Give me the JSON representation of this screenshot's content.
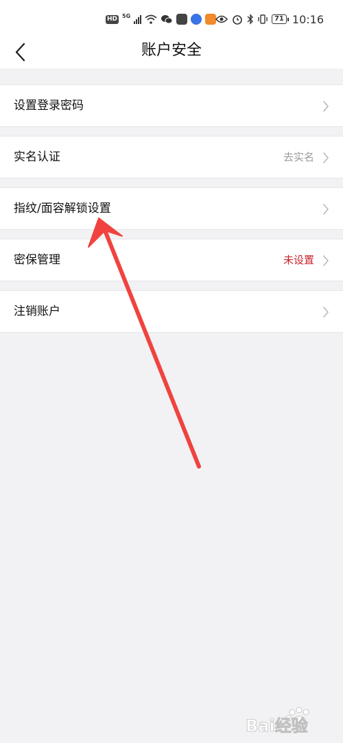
{
  "status": {
    "net_badge": "HD",
    "signal": "5G",
    "battery": "71",
    "time": "10:16"
  },
  "nav": {
    "back_icon": "chevron-left-icon",
    "title": "账户安全"
  },
  "rows": [
    {
      "label": "设置登录密码",
      "value": ""
    },
    {
      "label": "实名认证",
      "value": "去实名"
    },
    {
      "label": "指纹/面容解锁设置",
      "value": ""
    },
    {
      "label": "密保管理",
      "value": "未设置"
    },
    {
      "label": "注销账户",
      "value": ""
    }
  ],
  "colors": {
    "background": "#f2f2f4",
    "warning_text": "#c8232c",
    "annotation_arrow": "#f0433f"
  },
  "watermark": {
    "text": "Bai经验"
  }
}
